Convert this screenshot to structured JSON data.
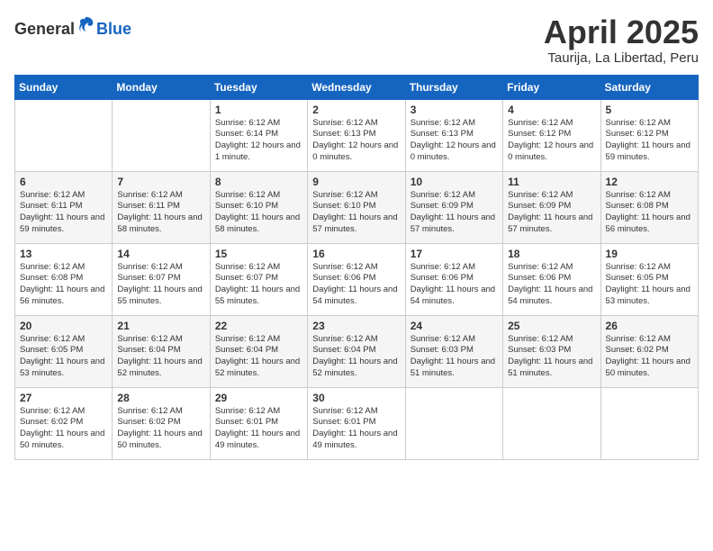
{
  "header": {
    "logo_general": "General",
    "logo_blue": "Blue",
    "month_year": "April 2025",
    "location": "Taurija, La Libertad, Peru"
  },
  "weekdays": [
    "Sunday",
    "Monday",
    "Tuesday",
    "Wednesday",
    "Thursday",
    "Friday",
    "Saturday"
  ],
  "rows": [
    [
      {
        "day": "",
        "info": ""
      },
      {
        "day": "",
        "info": ""
      },
      {
        "day": "1",
        "info": "Sunrise: 6:12 AM\nSunset: 6:14 PM\nDaylight: 12 hours and 1 minute."
      },
      {
        "day": "2",
        "info": "Sunrise: 6:12 AM\nSunset: 6:13 PM\nDaylight: 12 hours and 0 minutes."
      },
      {
        "day": "3",
        "info": "Sunrise: 6:12 AM\nSunset: 6:13 PM\nDaylight: 12 hours and 0 minutes."
      },
      {
        "day": "4",
        "info": "Sunrise: 6:12 AM\nSunset: 6:12 PM\nDaylight: 12 hours and 0 minutes."
      },
      {
        "day": "5",
        "info": "Sunrise: 6:12 AM\nSunset: 6:12 PM\nDaylight: 11 hours and 59 minutes."
      }
    ],
    [
      {
        "day": "6",
        "info": "Sunrise: 6:12 AM\nSunset: 6:11 PM\nDaylight: 11 hours and 59 minutes."
      },
      {
        "day": "7",
        "info": "Sunrise: 6:12 AM\nSunset: 6:11 PM\nDaylight: 11 hours and 58 minutes."
      },
      {
        "day": "8",
        "info": "Sunrise: 6:12 AM\nSunset: 6:10 PM\nDaylight: 11 hours and 58 minutes."
      },
      {
        "day": "9",
        "info": "Sunrise: 6:12 AM\nSunset: 6:10 PM\nDaylight: 11 hours and 57 minutes."
      },
      {
        "day": "10",
        "info": "Sunrise: 6:12 AM\nSunset: 6:09 PM\nDaylight: 11 hours and 57 minutes."
      },
      {
        "day": "11",
        "info": "Sunrise: 6:12 AM\nSunset: 6:09 PM\nDaylight: 11 hours and 57 minutes."
      },
      {
        "day": "12",
        "info": "Sunrise: 6:12 AM\nSunset: 6:08 PM\nDaylight: 11 hours and 56 minutes."
      }
    ],
    [
      {
        "day": "13",
        "info": "Sunrise: 6:12 AM\nSunset: 6:08 PM\nDaylight: 11 hours and 56 minutes."
      },
      {
        "day": "14",
        "info": "Sunrise: 6:12 AM\nSunset: 6:07 PM\nDaylight: 11 hours and 55 minutes."
      },
      {
        "day": "15",
        "info": "Sunrise: 6:12 AM\nSunset: 6:07 PM\nDaylight: 11 hours and 55 minutes."
      },
      {
        "day": "16",
        "info": "Sunrise: 6:12 AM\nSunset: 6:06 PM\nDaylight: 11 hours and 54 minutes."
      },
      {
        "day": "17",
        "info": "Sunrise: 6:12 AM\nSunset: 6:06 PM\nDaylight: 11 hours and 54 minutes."
      },
      {
        "day": "18",
        "info": "Sunrise: 6:12 AM\nSunset: 6:06 PM\nDaylight: 11 hours and 54 minutes."
      },
      {
        "day": "19",
        "info": "Sunrise: 6:12 AM\nSunset: 6:05 PM\nDaylight: 11 hours and 53 minutes."
      }
    ],
    [
      {
        "day": "20",
        "info": "Sunrise: 6:12 AM\nSunset: 6:05 PM\nDaylight: 11 hours and 53 minutes."
      },
      {
        "day": "21",
        "info": "Sunrise: 6:12 AM\nSunset: 6:04 PM\nDaylight: 11 hours and 52 minutes."
      },
      {
        "day": "22",
        "info": "Sunrise: 6:12 AM\nSunset: 6:04 PM\nDaylight: 11 hours and 52 minutes."
      },
      {
        "day": "23",
        "info": "Sunrise: 6:12 AM\nSunset: 6:04 PM\nDaylight: 11 hours and 52 minutes."
      },
      {
        "day": "24",
        "info": "Sunrise: 6:12 AM\nSunset: 6:03 PM\nDaylight: 11 hours and 51 minutes."
      },
      {
        "day": "25",
        "info": "Sunrise: 6:12 AM\nSunset: 6:03 PM\nDaylight: 11 hours and 51 minutes."
      },
      {
        "day": "26",
        "info": "Sunrise: 6:12 AM\nSunset: 6:02 PM\nDaylight: 11 hours and 50 minutes."
      }
    ],
    [
      {
        "day": "27",
        "info": "Sunrise: 6:12 AM\nSunset: 6:02 PM\nDaylight: 11 hours and 50 minutes."
      },
      {
        "day": "28",
        "info": "Sunrise: 6:12 AM\nSunset: 6:02 PM\nDaylight: 11 hours and 50 minutes."
      },
      {
        "day": "29",
        "info": "Sunrise: 6:12 AM\nSunset: 6:01 PM\nDaylight: 11 hours and 49 minutes."
      },
      {
        "day": "30",
        "info": "Sunrise: 6:12 AM\nSunset: 6:01 PM\nDaylight: 11 hours and 49 minutes."
      },
      {
        "day": "",
        "info": ""
      },
      {
        "day": "",
        "info": ""
      },
      {
        "day": "",
        "info": ""
      }
    ]
  ]
}
